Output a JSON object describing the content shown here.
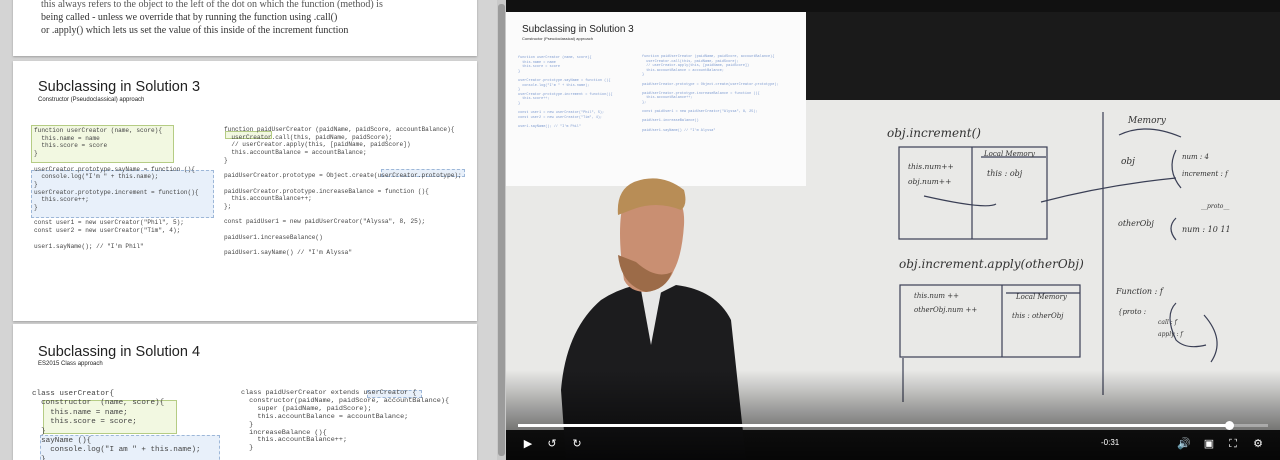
{
  "slides": {
    "s1": {
      "line1": "this always refers to the object to the left of the dot on which the function (method) is",
      "line2": "being called - unless we override that by running the function using .call()",
      "line3": "or .apply() which lets us set the value of this inside of the increment function"
    },
    "s2": {
      "title": "Subclassing in Solution 3",
      "subtitle": "Constructor (Pseudoclassical) approach",
      "left_code": [
        "function userCreator (name, score){",
        "  this.name = name",
        "  this.score = score",
        "}",
        "",
        "userCreator.prototype.sayName = function (){",
        "  console.log(\"I'm \" + this.name);",
        "}",
        "userCreator.prototype.increment = function(){",
        "  this.score++;",
        "}",
        "",
        "const user1 = new userCreator(\"Phil\", 5);",
        "const user2 = new userCreator(\"Tim\", 4);",
        "",
        "user1.sayName(); // \"I'm Phil\""
      ],
      "right_code": [
        "function paidUserCreator (paidName, paidScore, accountBalance){",
        "  userCreator.call(this, paidName, paidScore);",
        "  // userCreator.apply(this, [paidName, paidScore])",
        "  this.accountBalance = accountBalance;",
        "}",
        "",
        "paidUserCreator.prototype = Object.create(userCreator.prototype);",
        "",
        "paidUserCreator.prototype.increaseBalance = function (){",
        "  this.accountBalance++;",
        "};",
        "",
        "const paidUser1 = new paidUserCreator(\"Alyssa\", 8, 25);",
        "",
        "paidUser1.increaseBalance()",
        "",
        "paidUser1.sayName() // \"I'm Alyssa\""
      ]
    },
    "s3": {
      "title": "Subclassing in Solution 4",
      "subtitle": "ES2015 Class approach",
      "left_code": [
        "class userCreator{",
        "  constructor  (name, score){",
        "    this.name = name;",
        "    this.score = score;",
        "  }",
        "  sayName (){",
        "    console.log(\"I am \" + this.name);",
        "  }"
      ],
      "right_code": [
        "class paidUserCreator extends userCreator {",
        "  constructor(paidName, paidScore, accountBalance){",
        "    super (paidName, paidScore);",
        "    this.accountBalance = accountBalance;",
        "  }",
        "  increaseBalance (){",
        "    this.accountBalance++;",
        "  }"
      ]
    }
  },
  "video": {
    "slide_title": "Subclassing in Solution 3",
    "slide_subtitle": "Constructor (Pseudoclassical) approach",
    "time": "-0:31",
    "progress": 0.948,
    "whiteboard": {
      "call1": "obj.increment()",
      "local_memory_1": "Local Memory",
      "this_obj": "this : obj",
      "this_num": "this.num++",
      "obj_num": "obj.num++",
      "call2": "obj.increment.apply(otherObj)",
      "local_memory_2": "Local Memory",
      "this_num2": "this.num ++",
      "other_num": "otherObj.num ++",
      "this_other": "this : otherObj",
      "memory": "Memory",
      "obj": "obj",
      "num4": "num : 4",
      "increment": "increment : f",
      "proto": "__proto__",
      "other_obj": "otherObj",
      "num10": "num : 10 11",
      "function": "Function : f",
      "proto2": "{proto :",
      "call": "call : f",
      "apply": "apply : f"
    },
    "controls": {
      "play_icon": "play-icon",
      "rewind_icon": "rewind-icon",
      "forward_icon": "forward-icon",
      "volume_icon": "volume-icon",
      "pip_icon": "picture-in-picture-icon",
      "fullscreen_icon": "fullscreen-icon",
      "settings_icon": "settings-icon"
    }
  }
}
